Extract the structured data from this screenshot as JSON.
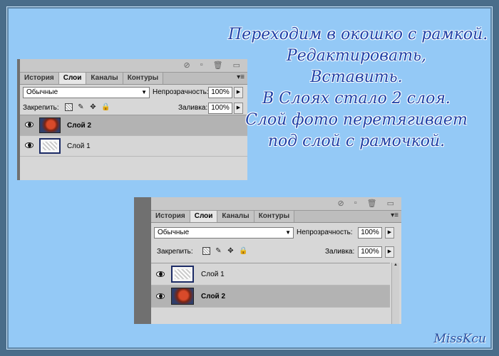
{
  "caption": {
    "lines": [
      "Переходим в окошко с рамкой.",
      "Редактировать,",
      "Вставить.",
      "В Слоях стало 2 слоя.",
      "Слой фото перетягивает",
      "под слой с рамочкой."
    ],
    "color": "#1f40a6"
  },
  "signature": "MissKcu",
  "panels": [
    {
      "tabs": [
        "История",
        "Слои",
        "Каналы",
        "Контуры"
      ],
      "active_tab": "Слои",
      "blend_mode": "Обычные",
      "opacity_label": "Непрозрачность:",
      "opacity_value": "100%",
      "lock_label": "Закрепить:",
      "fill_label": "Заливка:",
      "fill_value": "100%",
      "layers": [
        {
          "name": "Слой 2",
          "selected": true,
          "thumb": "photo"
        },
        {
          "name": "Слой 1",
          "selected": false,
          "thumb": "frame"
        }
      ]
    },
    {
      "tabs": [
        "История",
        "Слои",
        "Каналы",
        "Контуры"
      ],
      "active_tab": "Слои",
      "blend_mode": "Обычные",
      "opacity_label": "Непрозрачность:",
      "opacity_value": "100%",
      "lock_label": "Закрепить:",
      "fill_label": "Заливка:",
      "fill_value": "100%",
      "layers": [
        {
          "name": "Слой 1",
          "selected": false,
          "thumb": "frame"
        },
        {
          "name": "Слой 2",
          "selected": true,
          "thumb": "photo"
        }
      ]
    }
  ],
  "colors": {
    "background": "#94c9f6",
    "panel": "#d7d7d7",
    "selected_layer": "#b3b3b3"
  }
}
